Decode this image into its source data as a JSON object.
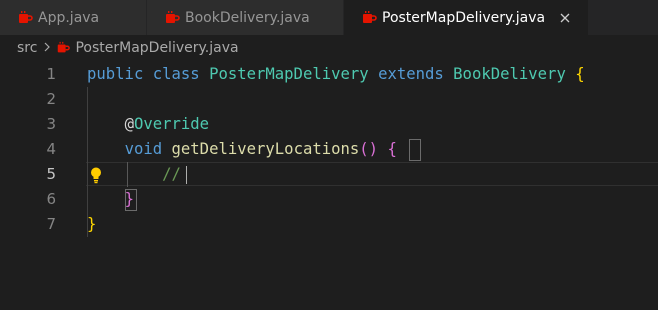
{
  "tabs": [
    {
      "label": "App.java",
      "active": false
    },
    {
      "label": "BookDelivery.java",
      "active": false
    },
    {
      "label": "PosterMapDelivery.java",
      "active": true
    }
  ],
  "breadcrumb": {
    "folder": "src",
    "file": "PosterMapDelivery.java"
  },
  "editor": {
    "current_line": 5,
    "lines": [
      {
        "number": "1",
        "tokens": [
          {
            "text": "public ",
            "kind": "kw"
          },
          {
            "text": "class ",
            "kind": "kw"
          },
          {
            "text": "PosterMapDelivery ",
            "kind": "type"
          },
          {
            "text": "extends ",
            "kind": "kw"
          },
          {
            "text": "BookDelivery ",
            "kind": "type"
          },
          {
            "text": "{",
            "kind": "brace1"
          }
        ]
      },
      {
        "number": "2",
        "tokens": []
      },
      {
        "number": "3",
        "tokens": [
          {
            "text": "    ",
            "kind": "plain"
          },
          {
            "text": "@",
            "kind": "annot"
          },
          {
            "text": "Override",
            "kind": "annot-name"
          }
        ]
      },
      {
        "number": "4",
        "tokens": [
          {
            "text": "    ",
            "kind": "plain"
          },
          {
            "text": "void ",
            "kind": "kw"
          },
          {
            "text": "getDeliveryLocations",
            "kind": "fn"
          },
          {
            "text": "() ",
            "kind": "brace2"
          },
          {
            "text": "{",
            "kind": "brace2"
          }
        ]
      },
      {
        "number": "5",
        "tokens": [
          {
            "text": "        ",
            "kind": "plain"
          },
          {
            "text": "//",
            "kind": "comment"
          }
        ]
      },
      {
        "number": "6",
        "tokens": [
          {
            "text": "    ",
            "kind": "plain"
          },
          {
            "text": "}",
            "kind": "brace2"
          }
        ]
      },
      {
        "number": "7",
        "tokens": [
          {
            "text": "}",
            "kind": "brace1"
          }
        ]
      }
    ]
  },
  "colors": {
    "file_icon": "#e51400",
    "lightbulb": "#ffcc00",
    "background": "#1e1e1e"
  },
  "icons": {
    "java_file": "java-cup-icon",
    "close": "close-icon",
    "lightbulb": "lightbulb-icon",
    "chevron": "chevron-right-icon"
  }
}
